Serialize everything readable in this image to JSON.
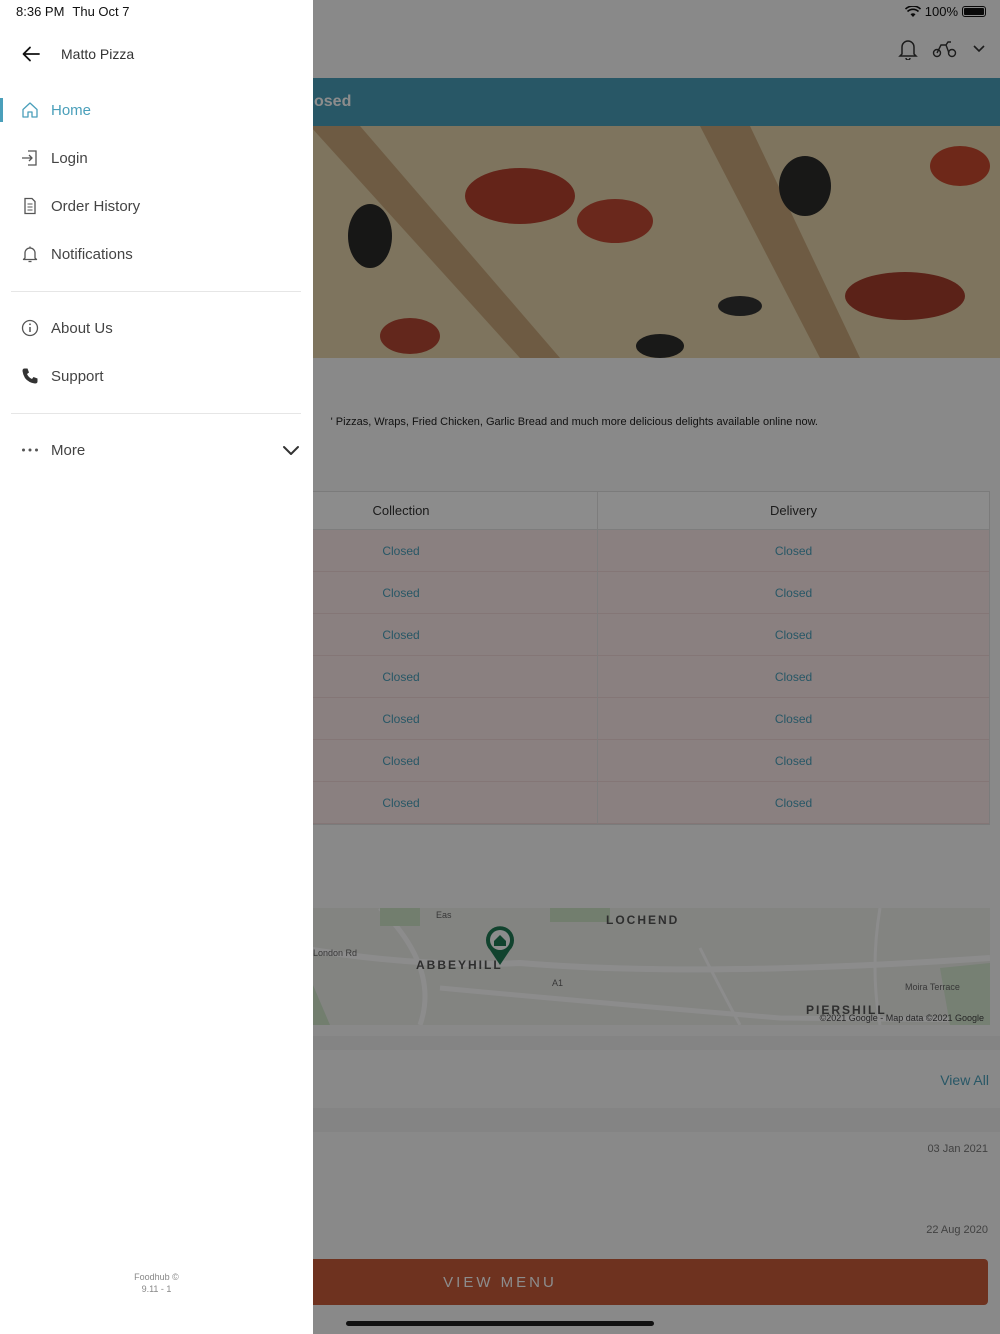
{
  "status_bar": {
    "time": "8:36 PM",
    "date": "Thu Oct 7",
    "battery": "100%"
  },
  "drawer": {
    "store_name": "Matto Pizza",
    "items": [
      {
        "label": "Home",
        "icon": "home-icon",
        "active": true
      },
      {
        "label": "Login",
        "icon": "login-icon"
      },
      {
        "label": "Order History",
        "icon": "order-history-icon"
      },
      {
        "label": "Notifications",
        "icon": "bell-icon"
      },
      {
        "label": "About Us",
        "icon": "info-icon"
      },
      {
        "label": "Support",
        "icon": "phone-icon"
      },
      {
        "label": "More",
        "icon": "more-dots-icon"
      }
    ],
    "footer_line1": "Foodhub ©",
    "footer_line2": "9.11 - 1"
  },
  "background": {
    "banner_text": "osed",
    "about_text": "' Pizzas, Wraps, Fried Chicken, Garlic Bread and much more delicious delights available online now.",
    "hours": {
      "col_collection": "Collection",
      "col_delivery": "Delivery",
      "rows": [
        {
          "collection": "Closed",
          "delivery": "Closed"
        },
        {
          "collection": "Closed",
          "delivery": "Closed"
        },
        {
          "collection": "Closed",
          "delivery": "Closed"
        },
        {
          "collection": "Closed",
          "delivery": "Closed"
        },
        {
          "collection": "Closed",
          "delivery": "Closed"
        },
        {
          "collection": "Closed",
          "delivery": "Closed"
        },
        {
          "collection": "Closed",
          "delivery": "Closed"
        }
      ]
    },
    "map": {
      "label_lochend": "LOCHEND",
      "label_abbeyhill": "ABBEYHILL",
      "label_piershill": "PIERSHILL",
      "label_london_rd": "London Rd",
      "label_a1": "A1",
      "label_moira": "Moira Terrace",
      "label_eas": "Eas",
      "copyright": "©2021 Google - Map data ©2021 Google"
    },
    "view_all": "View All",
    "review_dates": [
      "03 Jan 2021",
      "22 Aug 2020"
    ],
    "view_menu": "VIEW MENU"
  },
  "colors": {
    "accent": "#4a9fba",
    "menu_button": "#c85b3a",
    "closed_bg": "#fbe9e9"
  }
}
